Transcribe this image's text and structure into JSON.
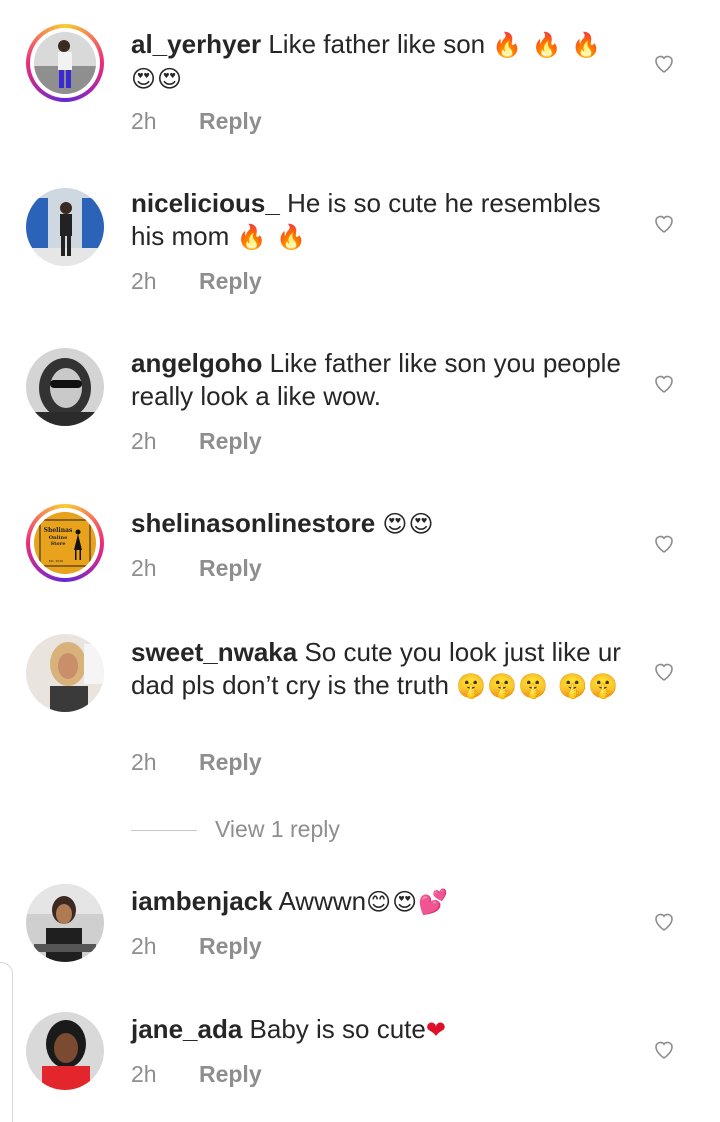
{
  "comments": [
    {
      "username": "al_yerhyer",
      "text": "Like father like son",
      "emoji": "🔥 🔥 🔥 😍😍",
      "time": "2h",
      "reply": "Reply"
    },
    {
      "username": "nicelicious_",
      "text": "He is so cute he resembles his mom",
      "emoji": "🔥 🔥",
      "time": "2h",
      "reply": "Reply"
    },
    {
      "username": "angelgoho",
      "text": "Like father like son you people really look a like wow.",
      "emoji": "",
      "time": "2h",
      "reply": "Reply"
    },
    {
      "username": "shelinasonlinestore",
      "text": "",
      "emoji": "😍😍",
      "time": "2h",
      "reply": "Reply"
    },
    {
      "username": "sweet_nwaka",
      "text": "So cute you look just like ur dad pls don’t cry is the truth",
      "emoji": "🤫🤫🤫 🤫🤫",
      "time": "2h",
      "reply": "Reply"
    },
    {
      "username": "iambenjack",
      "text": "Awwwn",
      "emoji": "😊😍💕",
      "time": "2h",
      "reply": "Reply"
    },
    {
      "username": "jane_ada",
      "text": "Baby is so cute",
      "emoji": "❤",
      "time": "2h",
      "reply": "Reply"
    }
  ],
  "view_replies": "View 1 reply",
  "avatar_logo": {
    "line1": "Shelinas",
    "line2": "Online",
    "line3": "Store",
    "line4": "Est. 2016"
  },
  "icons": {
    "like": "heart-outline-icon"
  },
  "colors": {
    "text": "#262626",
    "meta": "#8e8e8e",
    "ring": "#ee2a7b",
    "logo_bg": "#e8a21c",
    "emoji_heart": "#e0102a"
  }
}
